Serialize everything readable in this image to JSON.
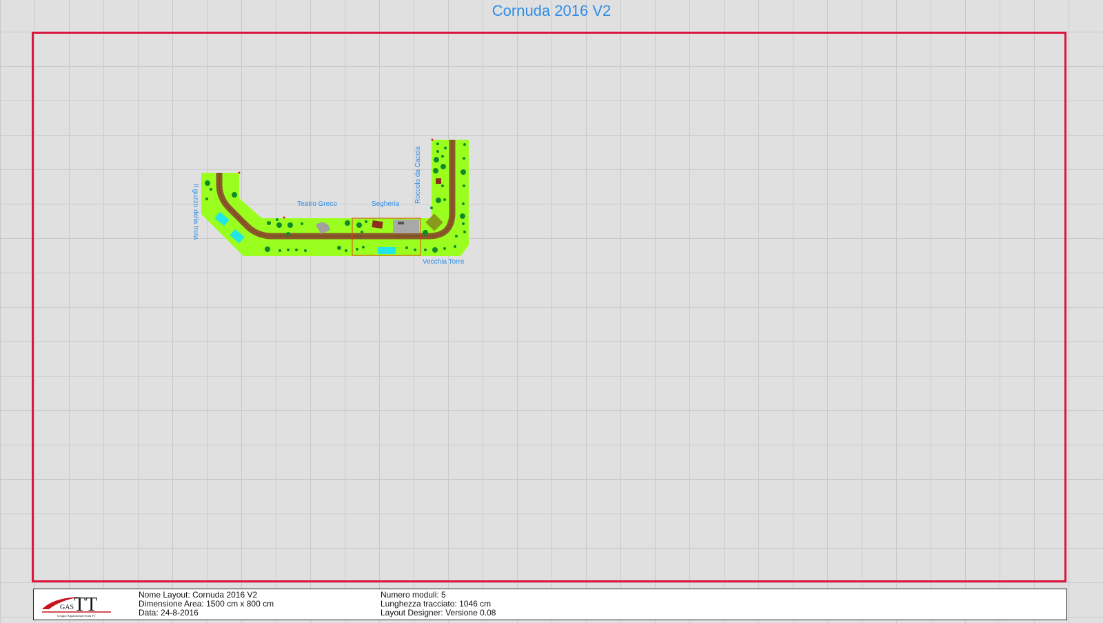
{
  "title": "Cornuda 2016 V2",
  "labels": {
    "gozzo": "Il guzzo della trota",
    "teatro": "Teatro Greco",
    "segheria": "Segheria",
    "roccolo": "Roccolo da Caccia",
    "torre": "Vecchia Torre"
  },
  "logo": {
    "main": "TT",
    "prefix": "GAS",
    "subtitle": "Gruppo Appassionati Scala TT"
  },
  "info": {
    "nome_label": "Nome Layout:",
    "nome_value": "Cornuda 2016 V2",
    "dimensione_label": "Dimensione Area:",
    "dimensione_value": "1500 cm x 800 cm",
    "data_label": "Data:",
    "data_value": "24-8-2016",
    "moduli_label": "Numero moduli:",
    "moduli_value": "5",
    "lunghezza_label": "Lunghezza tracciato:",
    "lunghezza_value": "1046 cm",
    "designer_label": "Layout Designer:",
    "designer_value": "Versione 0.08"
  },
  "colors": {
    "frame": "#dc143c",
    "title": "#2f8ce6",
    "ground": "#9aff1e",
    "track": "#8b5a2b",
    "tree": "#0f8a2a",
    "water": "#22e6e6"
  }
}
